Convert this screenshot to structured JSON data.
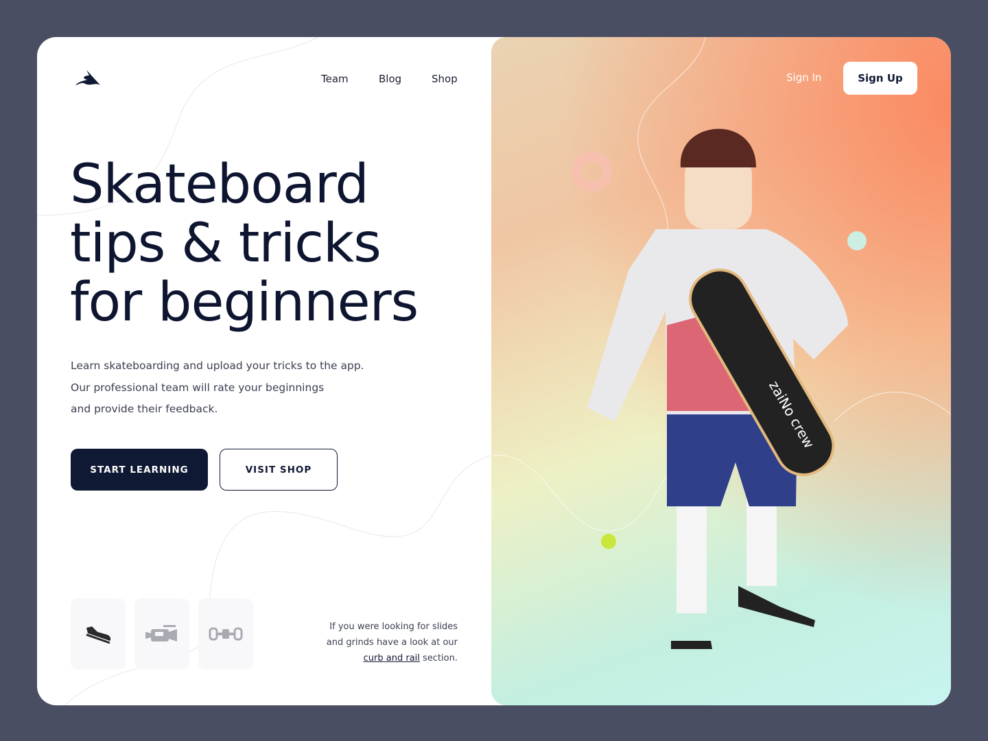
{
  "nav": {
    "items": [
      "Team",
      "Blog",
      "Shop"
    ],
    "sign_in": "Sign In",
    "sign_up": "Sign Up"
  },
  "hero": {
    "lines": [
      "Skateboard",
      "tips & tricks",
      "for beginners"
    ],
    "description": [
      "Learn skateboarding and upload your tricks to the app.",
      "Our professional team will rate your beginnings",
      "and provide their feedback."
    ]
  },
  "buttons": {
    "start": "START LEARNING",
    "shop": "VISIT SHOP"
  },
  "tiles": [
    "shoe-icon",
    "video-camera-icon",
    "skateboard-truck-icon"
  ],
  "note": {
    "line1": "If you were looking for slides",
    "line2": "and grinds have a look at our",
    "link": "curb and rail",
    "tail": " section."
  },
  "illustration": {
    "board_lettering": "zaiNo crew"
  },
  "colors": {
    "primary": "#101934",
    "background": "#4a4e62",
    "accent": "#fa8a62"
  }
}
